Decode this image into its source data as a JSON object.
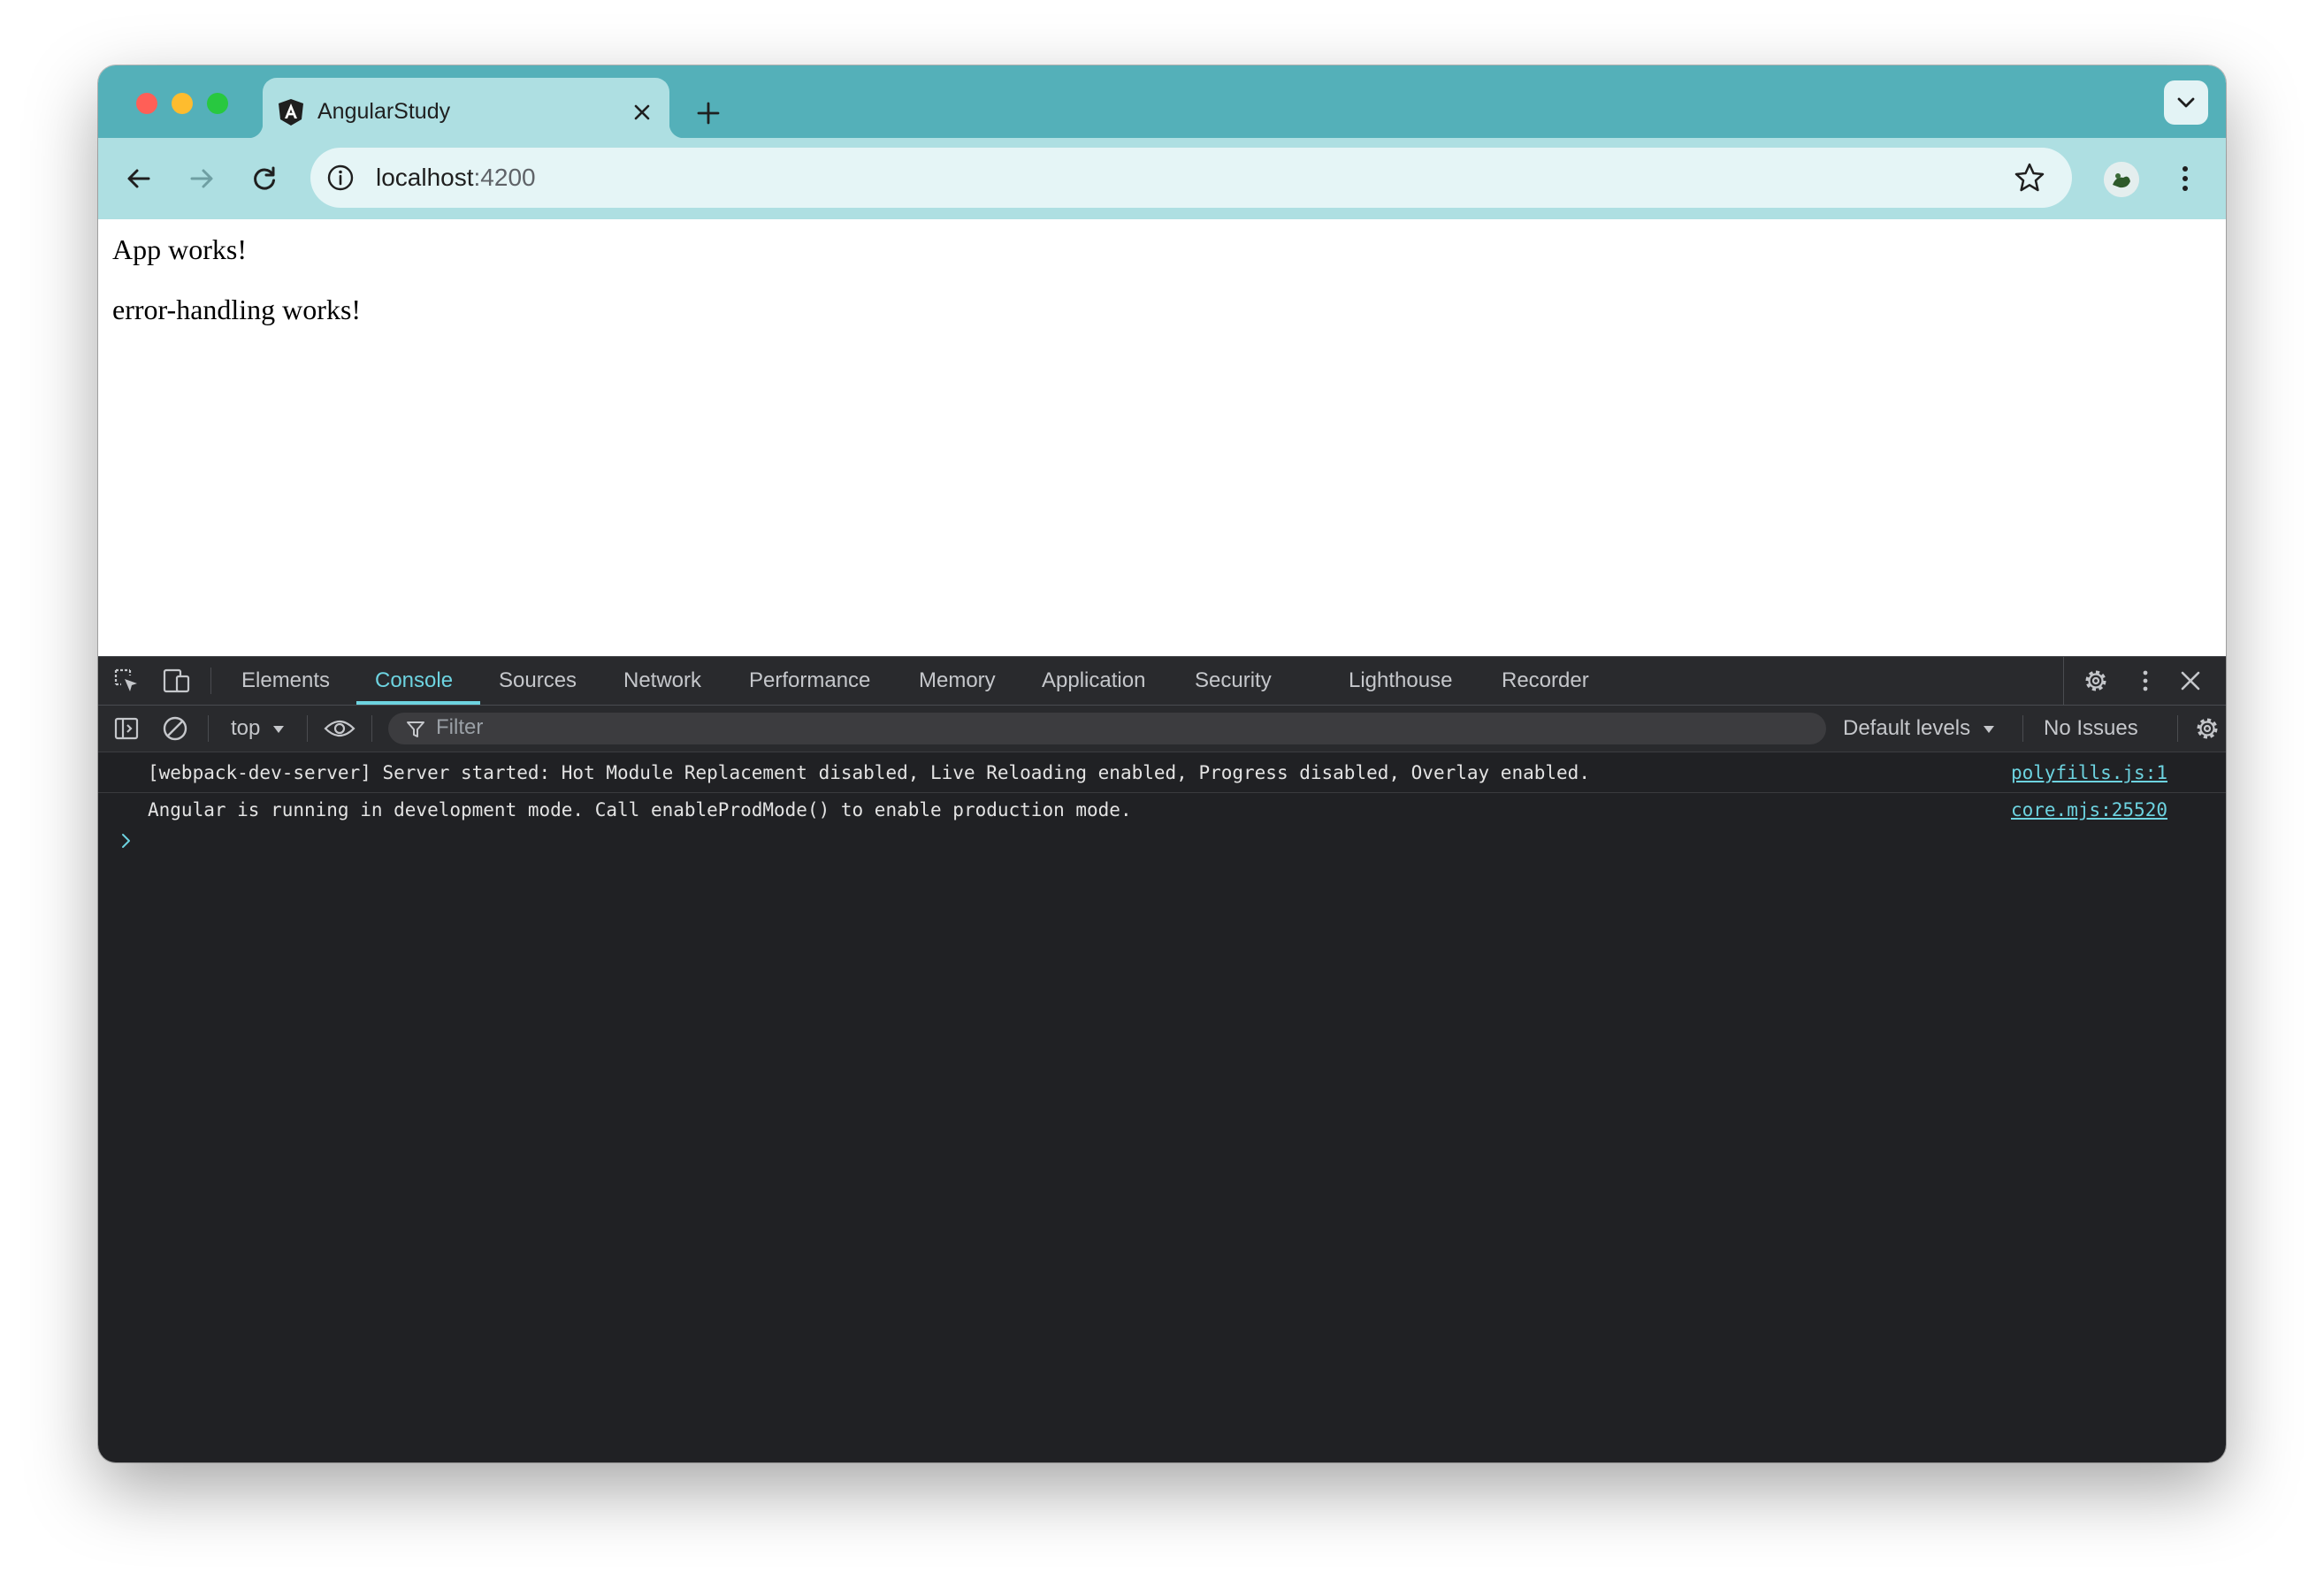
{
  "browser": {
    "tab": {
      "title": "AngularStudy",
      "favicon": "angular-logo-icon"
    },
    "address": {
      "host": "localhost",
      "port": ":4200"
    }
  },
  "page": {
    "lines": [
      "App works!",
      "error-handling works!"
    ]
  },
  "devtools": {
    "tabs": [
      "Elements",
      "Console",
      "Sources",
      "Network",
      "Performance",
      "Memory",
      "Application",
      "Security",
      "Lighthouse",
      "Recorder"
    ],
    "active_tab": "Console",
    "console_toolbar": {
      "context": "top",
      "filter_placeholder": "Filter",
      "levels": "Default levels",
      "issues": "No Issues"
    },
    "messages": [
      {
        "text": "[webpack-dev-server] Server started: Hot Module Replacement disabled, Live Reloading enabled, Progress disabled, Overlay enabled.",
        "source": "polyfills.js:1"
      },
      {
        "text": "Angular is running in development mode. Call enableProdMode() to enable production mode.",
        "source": "core.mjs:25520"
      }
    ]
  },
  "colors": {
    "tabstrip": "#54b0b9",
    "toolbar": "#aedfe2",
    "devtools_bg": "#202124",
    "accent": "#6dd3e0"
  }
}
